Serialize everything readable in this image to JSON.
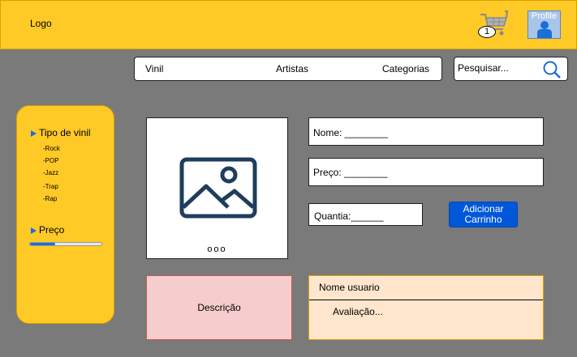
{
  "header": {
    "logo": "Logo",
    "cart_count": "1",
    "cart_icon": "shopping-cart-icon",
    "profile_label": "Profile",
    "profile_icon": "user-avatar-icon",
    "background": "#ffc926"
  },
  "nav": {
    "items": [
      {
        "label": "Vinil"
      },
      {
        "label": "Artistas"
      },
      {
        "label": "Categorias"
      }
    ]
  },
  "search": {
    "placeholder": "Pesquisar...",
    "icon": "search-icon"
  },
  "sidebar": {
    "filter_type": {
      "title": "Tipo de vinil",
      "options": [
        "-Rock",
        "-POP",
        "-Jazz",
        "-Trap",
        "-Rap"
      ]
    },
    "filter_price": {
      "title": "Preço",
      "slider_fraction": 0.35
    }
  },
  "product": {
    "image_icon": "image-placeholder-icon",
    "carousel_dots": "ooo",
    "name_label": "Nome: ________",
    "price_label": "Preço: ________",
    "quantity_label": "Quantia:______",
    "add_button": "Adicionar Carrinho",
    "description": "Descrição"
  },
  "review": {
    "user": "Nome usuario",
    "rating": "Avaliação..."
  },
  "colors": {
    "accent": "#0057d9",
    "yellow": "#ffc926",
    "background": "#7a7a7a"
  }
}
